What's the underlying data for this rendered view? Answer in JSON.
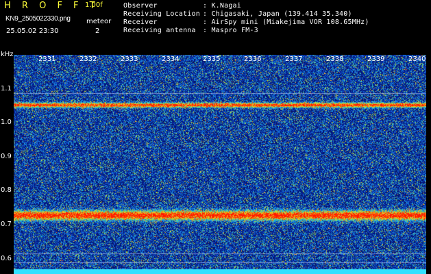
{
  "header": {
    "brand": "H R O F F T",
    "version": "1.00f",
    "filename": "KN9_2505022330.png",
    "meteor_label": "meteor",
    "datetime": "25.05.02 23:30",
    "meteor_count": "2"
  },
  "info": [
    {
      "key": "Observer",
      "value": ": K.Nagai"
    },
    {
      "key": "Receiving Location",
      "value": ": Chigasaki, Japan (139.414 35.340)"
    },
    {
      "key": "Receiver",
      "value": ": AirSpy mini (Miakejima VOR 108.65MHz)"
    },
    {
      "key": "Receiving antenna",
      "value": ": Maspro FM-3"
    }
  ],
  "axis": {
    "y_unit": "kHz",
    "y_ticks": [
      "1.1",
      "1.0",
      "0.9",
      "0.8",
      "0.7",
      "0.6"
    ],
    "x_ticks": [
      "2331",
      "2332",
      "2333",
      "2334",
      "2335",
      "2336",
      "2337",
      "2338",
      "2339",
      "2340"
    ]
  },
  "colors": {
    "background": "#000000",
    "header_yellow": "#ffff3a",
    "header_white": "#ffffff",
    "noise_low": "#0a1a9c",
    "signal_high": "#ff2a00",
    "baseline_cyan": "#33e0ff"
  }
}
